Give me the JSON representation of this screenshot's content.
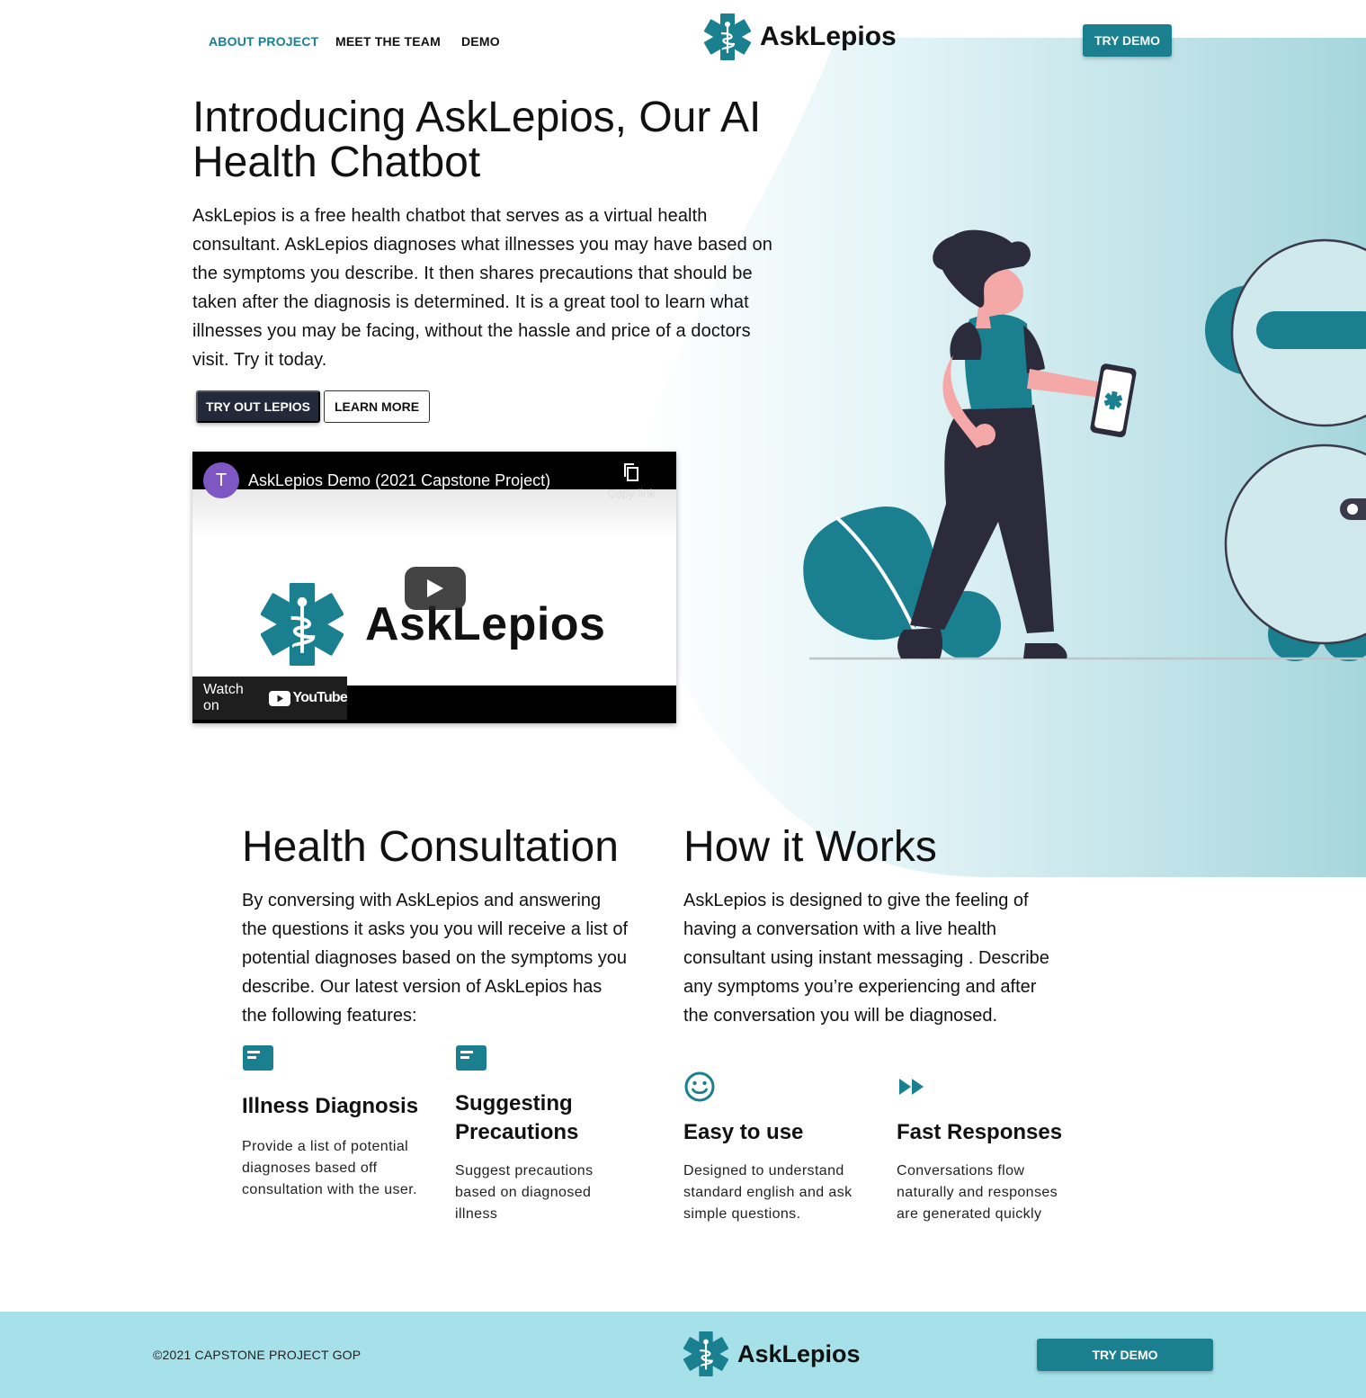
{
  "colors": {
    "accent": "#1a8090",
    "dark_button": "#24293a",
    "footer_bg": "#a6e1ea",
    "skin": "#f4a8a8",
    "outfit": "#2c2b3c"
  },
  "nav": {
    "links": [
      "ABOUT PROJECT",
      "MEET THE TEAM",
      "DEMO"
    ],
    "brand": "AskLepios",
    "cta": "TRY DEMO"
  },
  "hero": {
    "title": "Introducing AskLepios, Our AI Health Chatbot",
    "text": "AskLepios is a free health chatbot that serves as a virtual health consultant. AskLepios diagnoses what illnesses you may have based on the symptoms you describe. It then shares precautions that should be taken after the diagnosis is determined. It is a great tool to learn what illnesses you may be facing, without the hassle and price of a doctors visit. Try it today.",
    "primary_button": "TRY OUT LEPIOS",
    "secondary_button": "LEARN MORE"
  },
  "video": {
    "channel_initial": "T",
    "title": "AskLepios Demo (2021 Capstone Project)",
    "copy_link": "Copy link",
    "logo_text": "AskLepios",
    "watch_on": "Watch on",
    "youtube": "YouTube"
  },
  "consultation": {
    "title": "Health Consultation",
    "text": "By conversing with AskLepios and answering the questions it asks you you will receive a list of potential diagnoses based on the symptoms you describe. Our latest version of AskLepios has the following features:",
    "features": [
      {
        "icon": "card-icon",
        "title": "Illness Diagnosis",
        "text": "Provide a list of potential diagnoses based off consultation with the user."
      },
      {
        "icon": "card-icon",
        "title": "Suggesting Precautions",
        "text": "Suggest precautions based on diagnosed illness"
      }
    ]
  },
  "how": {
    "title": "How it Works",
    "text": "AskLepios is designed to give the feeling of having a conversation with a live health consultant using instant messaging . Describe any symptoms you’re experiencing and after the conversation you will be diagnosed.",
    "features": [
      {
        "icon": "smiley-icon",
        "title": "Easy to use",
        "text": "Designed to understand standard english and ask simple questions."
      },
      {
        "icon": "fast-forward-icon",
        "title": "Fast Responses",
        "text": "Conversations flow naturally and responses are generated quickly"
      }
    ]
  },
  "footer": {
    "copyright": "©2021 CAPSTONE PROJECT GOP",
    "brand": "AskLepios",
    "cta": "TRY DEMO"
  }
}
